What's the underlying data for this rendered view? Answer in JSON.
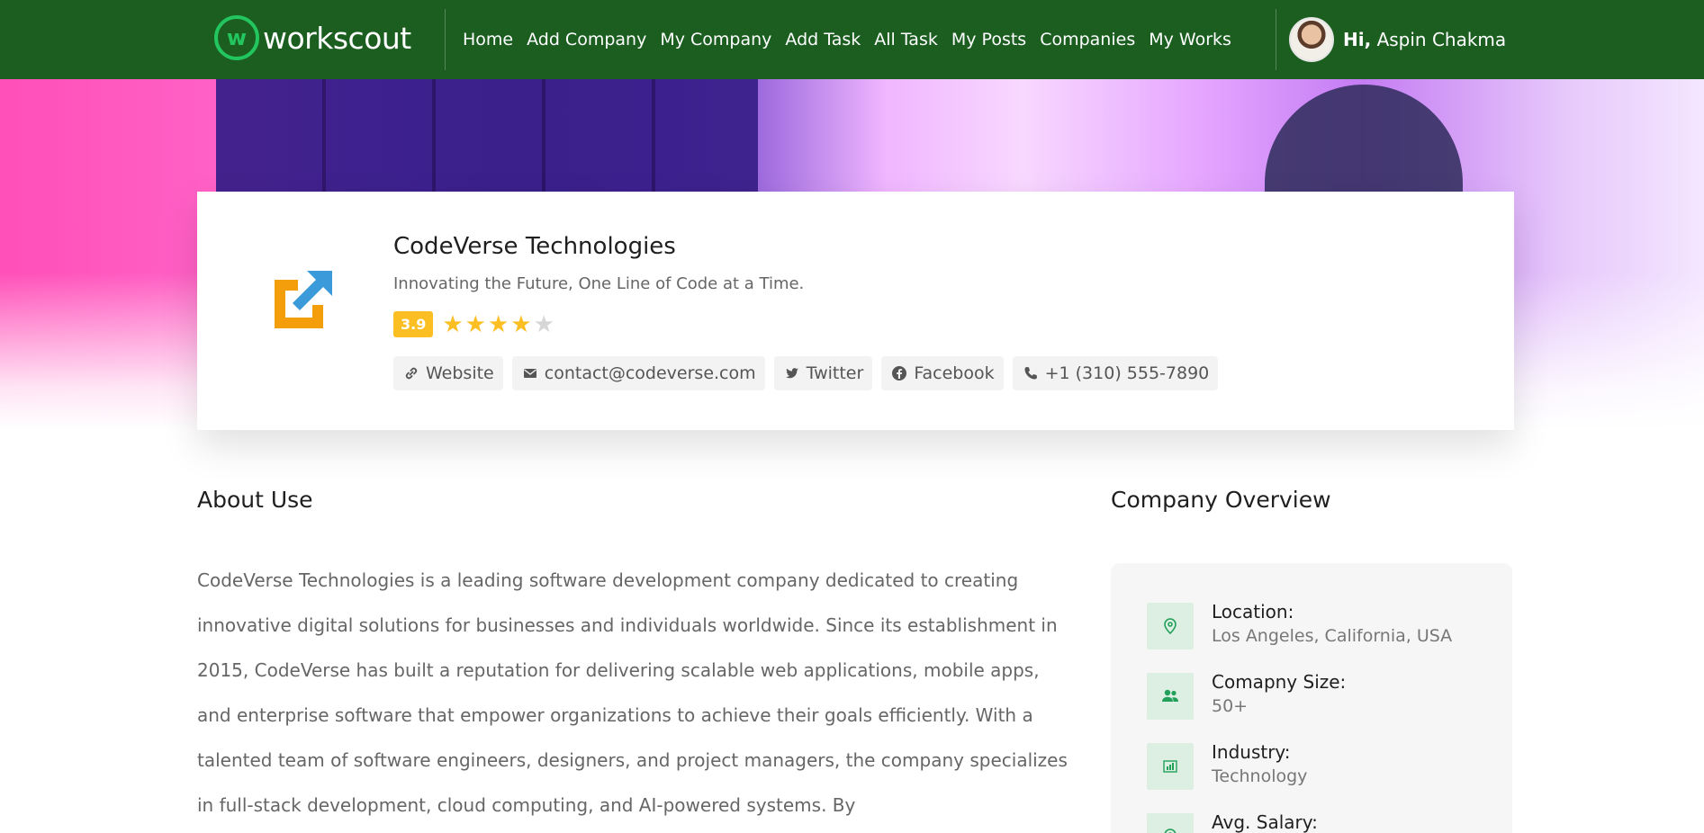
{
  "brand": {
    "name": "workscout",
    "mark_letter": "w"
  },
  "nav": {
    "links": [
      "Home",
      "Add Company",
      "My Company",
      "Add Task",
      "All Task",
      "My Posts",
      "Companies",
      "My Works"
    ]
  },
  "user": {
    "greeting": "Hi,",
    "name": "Aspin Chakma"
  },
  "company": {
    "name": "CodeVerse Technologies",
    "tagline": "Innovating the Future, One Line of Code at a Time.",
    "rating": "3.9",
    "rating_value": 3.9,
    "stars_filled": 4,
    "stars_total": 5,
    "links": {
      "website": "Website",
      "email": "contact@codeverse.com",
      "twitter": "Twitter",
      "facebook": "Facebook",
      "phone": "+1 (310) 555-7890"
    }
  },
  "about": {
    "title": "About Use",
    "body": "CodeVerse Technologies is a leading software development company dedicated to creating innovative digital solutions for businesses and individuals worldwide. Since its establishment in 2015, CodeVerse has built a reputation for delivering scalable web applications, mobile apps, and enterprise software that empower organizations to achieve their goals efficiently. With a talented team of software engineers, designers, and project managers, the company specializes in full-stack development, cloud computing, and AI-powered systems. By"
  },
  "overview": {
    "title": "Company Overview",
    "location": {
      "label": "Location:",
      "value": "Los Angeles, California, USA"
    },
    "size": {
      "label": "Comapny Size:",
      "value": "50+"
    },
    "industry": {
      "label": "Industry:",
      "value": "Technology"
    },
    "salary": {
      "label": "Avg. Salary:"
    }
  },
  "colors": {
    "nav_bg": "#1b5e20",
    "accent_green": "#22c55e",
    "star": "#fbbf24",
    "logo_orange": "#f59e0b",
    "logo_blue": "#3b9ad9"
  },
  "icons": {
    "website": "link-icon",
    "email": "envelope-icon",
    "twitter": "twitter-icon",
    "facebook": "facebook-icon",
    "phone": "phone-icon",
    "location": "map-pin-icon",
    "size": "users-icon",
    "industry": "chart-icon",
    "salary": "map-pin-icon"
  }
}
